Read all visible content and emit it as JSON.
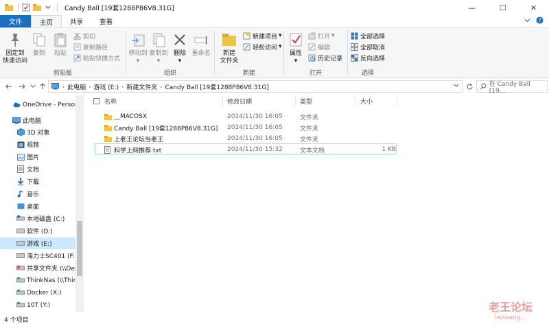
{
  "window": {
    "title": "Candy Ball [19套1288P86V8.31G]"
  },
  "tabs": [
    {
      "label": "文件"
    },
    {
      "label": "主页"
    },
    {
      "label": "共享"
    },
    {
      "label": "查看"
    }
  ],
  "ribbon": {
    "clipboard": {
      "group_label": "剪贴板",
      "pin_quick_access": "固定到",
      "pin_quick_access2": "快速访问",
      "copy": "复制",
      "paste": "粘贴",
      "cut": "剪切",
      "copy_path": "复制路径",
      "paste_shortcut": "粘贴快捷方式"
    },
    "organize": {
      "group_label": "组织",
      "move_to": "移动到",
      "copy_to": "复制到",
      "delete": "删除",
      "rename": "重命名"
    },
    "new": {
      "group_label": "新建",
      "new_folder": "新建",
      "new_folder2": "文件夹",
      "new_item": "新建项目",
      "easy_access": "轻松访问"
    },
    "open": {
      "group_label": "打开",
      "properties": "属性",
      "open": "打开",
      "edit": "编辑",
      "history": "历史记录"
    },
    "select": {
      "group_label": "选择",
      "select_all": "全部选择",
      "select_none": "全部取消",
      "invert": "反向选择"
    }
  },
  "address": {
    "crumbs": [
      "此电脑",
      "游戏 (E:)",
      "新建文件夹",
      "Candy Ball [19套1288P86V8.31G]"
    ],
    "search_placeholder": "在 Candy Ball [19..."
  },
  "nav": {
    "items": [
      {
        "label": "OneDrive - Person"
      },
      {
        "label": "此电脑"
      },
      {
        "label": "3D 对象"
      },
      {
        "label": "视频"
      },
      {
        "label": "图片"
      },
      {
        "label": "文档"
      },
      {
        "label": "下载"
      },
      {
        "label": "音乐"
      },
      {
        "label": "桌面"
      },
      {
        "label": "本地磁盘 (C:)"
      },
      {
        "label": "软件 (D:)"
      },
      {
        "label": "游戏 (E:)"
      },
      {
        "label": "海力士SC401 (F:)"
      },
      {
        "label": "共享文件夹 (\\\\Des"
      },
      {
        "label": "ThinkNas (\\\\Thin"
      },
      {
        "label": "Docker (X:)"
      },
      {
        "label": "10T (Y:)"
      }
    ]
  },
  "list": {
    "headers": {
      "name": "名称",
      "date": "修改日期",
      "type": "类型",
      "size": "大小"
    },
    "rows": [
      {
        "name": "__MACOSX",
        "date": "2024/11/30 16:05",
        "type": "文件夹",
        "size": ""
      },
      {
        "name": "Candy Ball [19套1288P86V8.31G]",
        "date": "2024/11/30 16:05",
        "type": "文件夹",
        "size": ""
      },
      {
        "name": "上老王论坛当老王",
        "date": "2024/11/30 16:05",
        "type": "文件夹",
        "size": ""
      },
      {
        "name": "科学上网推荐.txt",
        "date": "2024/11/30 15:32",
        "type": "文本文档",
        "size": "1 KB"
      }
    ]
  },
  "status": {
    "count": "4 个项目"
  },
  "watermark": {
    "cn": "老王论坛",
    "en": "laowang..."
  },
  "colors": {
    "file_tab": "#1a6fc2",
    "folder": "#f0c14b",
    "selected": "#cce8ff",
    "focus_border": "#99d1ff"
  }
}
